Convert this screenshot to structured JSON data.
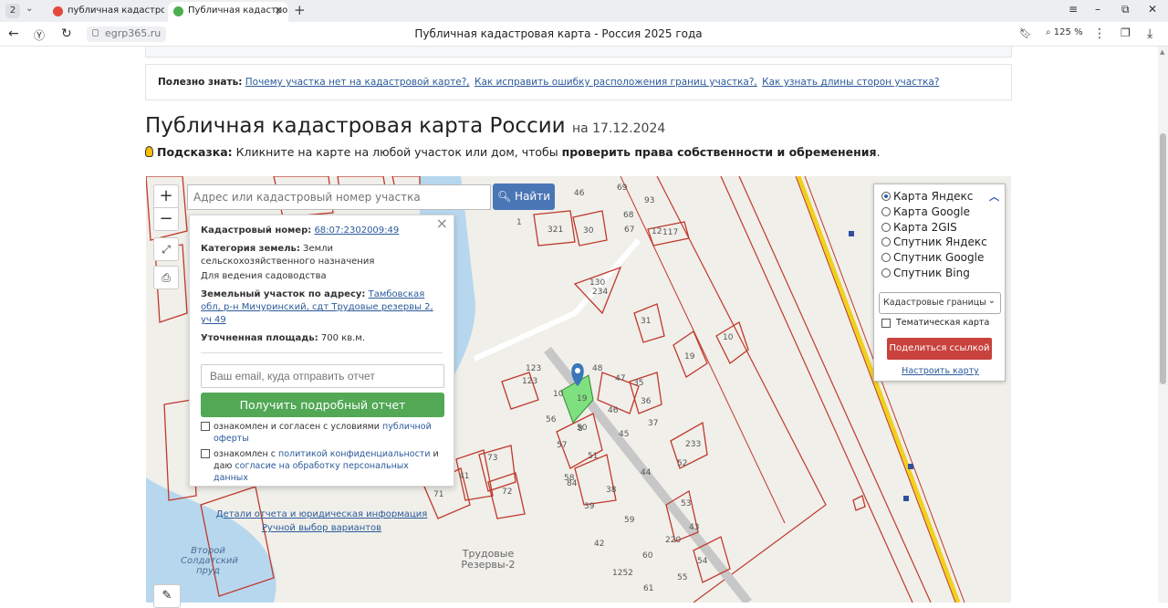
{
  "browser": {
    "tab_count": "2",
    "tabs": [
      {
        "title": "публичная кадастровая к"
      },
      {
        "title": "Публичная кадастровая"
      }
    ],
    "domain": "egrp365.ru",
    "page_title": "Публичная кадастровая карта - Россия 2025 года",
    "zoom": "125 %"
  },
  "info_bar": {
    "label": "Полезно знать:",
    "links": [
      "Почему участка нет на кадастровой карте?,",
      "Как исправить ошибку расположения границ участка?,",
      "Как узнать длины сторон участка?"
    ]
  },
  "heading": {
    "title": "Публичная кадастровая карта России",
    "date": "на 17.12.2024"
  },
  "hint": {
    "label": "Подсказка:",
    "text": " Кликните на карте на любой участок или дом, чтобы ",
    "bold": "проверить права собственности и обременения",
    "end": "."
  },
  "map": {
    "search_placeholder": "Адрес или кадастровый номер участка",
    "find_label": "Найти",
    "zoom_in": "+",
    "zoom_out": "−",
    "labels": {
      "pond": "Второй Солдатский пруд",
      "settlement": "Трудовые Резервы-2"
    },
    "plot_numbers": [
      "46",
      "69",
      "93",
      "68",
      "67",
      "321",
      "30",
      "117",
      "1",
      "12",
      "234",
      "130",
      "31",
      "10",
      "19",
      "123",
      "123",
      "48",
      "47",
      "35",
      "36",
      "46",
      "19",
      "37",
      "56",
      "57",
      "50",
      "45",
      "233",
      "51",
      "58",
      "44",
      "38",
      "52",
      "39",
      "59",
      "53",
      "43",
      "220",
      "42",
      "60",
      "54",
      "1252",
      "61",
      "55",
      "41",
      "73",
      "72",
      "71",
      "84",
      "8",
      "10"
    ],
    "highlight_color": "#7ee07e",
    "marker_color": "#3a76b8"
  },
  "popup": {
    "cad_label": "Кадастровый номер:",
    "cad_value": "68:07:2302009:49",
    "cat_label": "Категория земель:",
    "cat_value": "Земли сельскохозяйственного назначения",
    "use_value": "Для ведения садоводства",
    "addr_label": "Земельный участок по адресу:",
    "addr_value": "Тамбовская обл, р-н Мичуринский, сдт Трудовые резервы 2, уч 49",
    "area_label": "Уточненная площадь:",
    "area_value": "700 кв.м.",
    "email_placeholder": "Ваш email, куда отправить отчет",
    "get_report": "Получить подробный отчет",
    "check1_text": "ознакомлен и согласен с условиями ",
    "check1_link": "публичной оферты",
    "check2_text": "ознакомлен с ",
    "check2_link": "политикой конфиденциальности",
    "check2_mid": " и даю ",
    "check2_link2": "согласие на обработку персональных данных",
    "details_link": "Детали отчета и юридическая информация",
    "manual_link": "Ручной выбор вариантов"
  },
  "layers": {
    "options": [
      "Карта Яндекс",
      "Карта Google",
      "Карта 2GIS",
      "Спутник Яндекс",
      "Спутник Google",
      "Спутник Bing"
    ],
    "selected": 0,
    "select_value": "Кадастровые границы",
    "thematic": "Тематическая карта",
    "share": "Поделиться ссылкой",
    "tune": "Настроить карту"
  },
  "colors": {
    "parcel_line": "#c0392b",
    "road": "#f0d020",
    "water": "#b7d7ee"
  }
}
